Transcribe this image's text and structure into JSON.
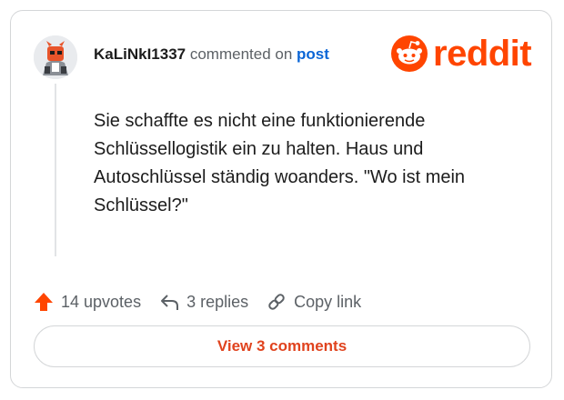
{
  "comment": {
    "username": "KaLiNkI1337",
    "action_text": " commented on ",
    "target_link": "post",
    "body": "Sie schaffte es nicht eine funktionierende Schlüssellogistik ein zu halten. Haus und Autoschlüssel ständig woanders. \"Wo ist mein Schlüssel?\"",
    "avatar_icon": "avatar-icon"
  },
  "brand": {
    "name": "reddit",
    "color": "#ff4500",
    "icon": "reddit-snoo-icon"
  },
  "actions": {
    "upvotes": "14 upvotes",
    "replies": "3 replies",
    "copy_link": "Copy link"
  },
  "view_comments_label": "View 3 comments",
  "colors": {
    "upvote": "#ff4500",
    "link": "#0b66d6",
    "button_text": "#e0431e"
  }
}
